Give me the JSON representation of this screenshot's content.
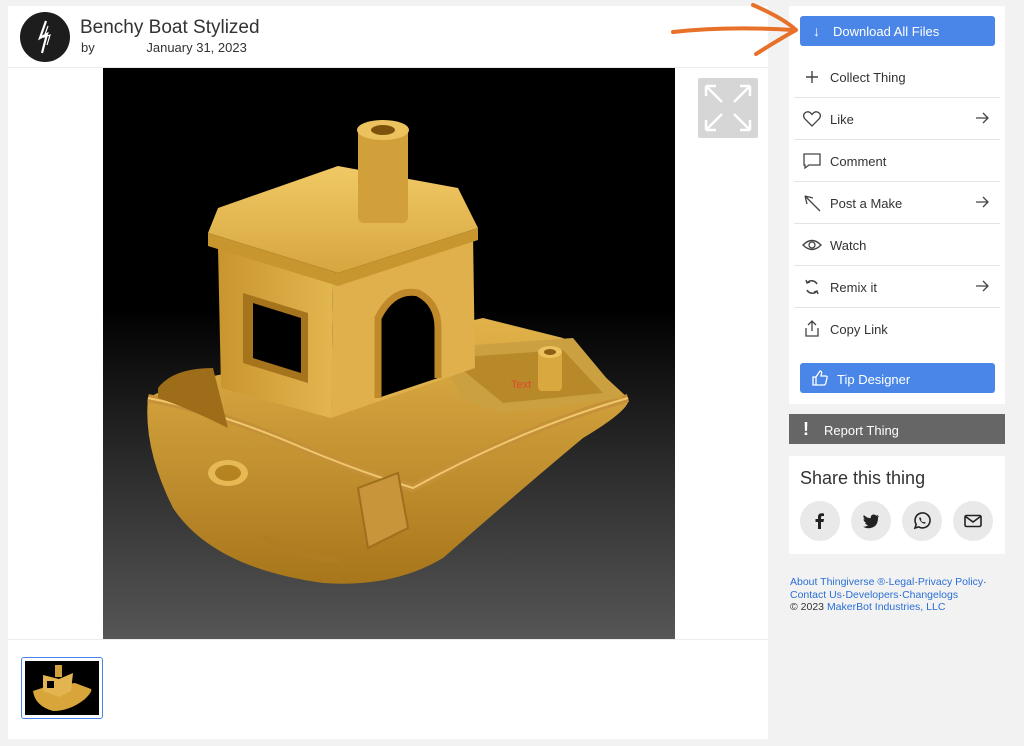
{
  "thing": {
    "title": "Benchy Boat Stylized",
    "by_label": "by",
    "date": "January 31, 2023",
    "model_overlay_text": "Text"
  },
  "actions": {
    "download_label": "Download All Files",
    "items": [
      {
        "label": "Collect Thing",
        "icon": "plus-icon",
        "has_arrow": false
      },
      {
        "label": "Like",
        "icon": "heart-icon",
        "has_arrow": true
      },
      {
        "label": "Comment",
        "icon": "comment-icon",
        "has_arrow": false
      },
      {
        "label": "Post a Make",
        "icon": "pencil-icon",
        "has_arrow": true
      },
      {
        "label": "Watch",
        "icon": "eye-icon",
        "has_arrow": false
      },
      {
        "label": "Remix it",
        "icon": "remix-icon",
        "has_arrow": true
      },
      {
        "label": "Copy Link",
        "icon": "share-upload-icon",
        "has_arrow": false
      }
    ],
    "tip_label": "Tip Designer",
    "report_label": "Report Thing"
  },
  "share": {
    "title": "Share this thing",
    "buttons": [
      "facebook-icon",
      "twitter-icon",
      "whatsapp-icon",
      "email-icon"
    ]
  },
  "footer": {
    "links_line1": [
      "About Thingiverse ®",
      "Legal",
      "Privacy Policy"
    ],
    "links_line2": [
      "Contact Us",
      "Developers",
      "Changelogs"
    ],
    "copyright_prefix": "©  2023",
    "company": "MakerBot Industries, LLC"
  },
  "colors": {
    "accent": "#4a86e8",
    "report": "#666666",
    "annotation_arrow": "#e8712a",
    "model_gold": "#d9a636"
  }
}
